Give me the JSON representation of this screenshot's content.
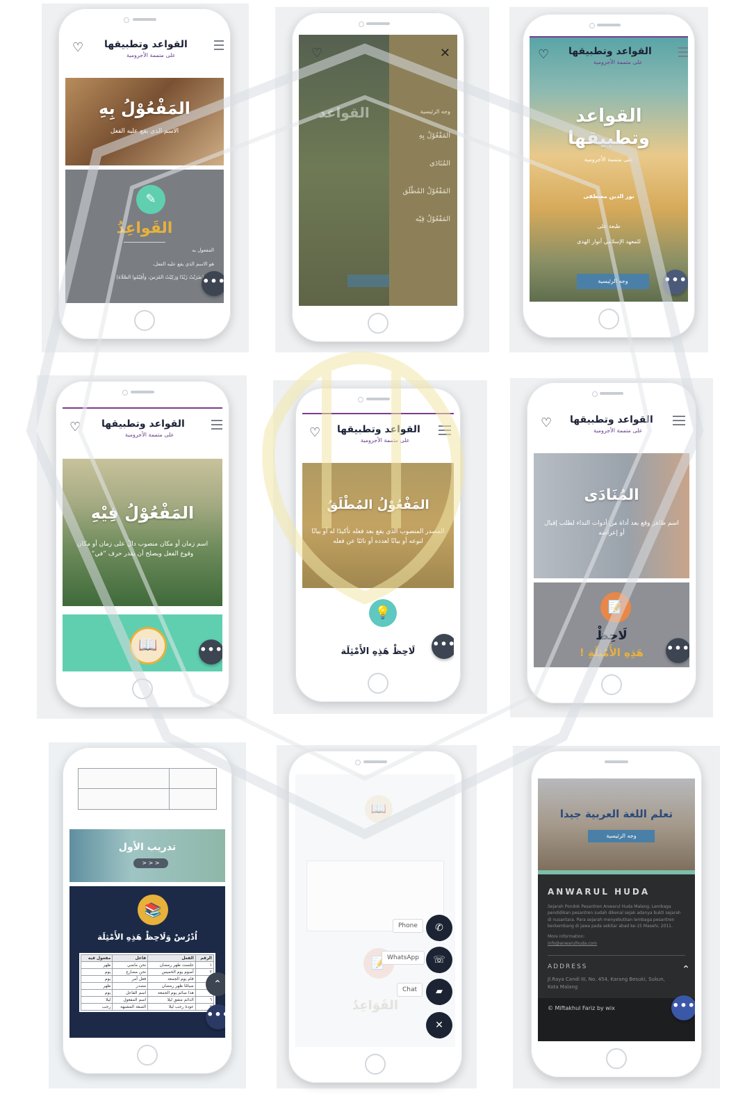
{
  "brand": {
    "title": "القواعد وتطبيقها",
    "subtitle": "على متممة الأجرومية"
  },
  "screens": {
    "s1": {
      "hero_title": "المَفْعُوْلُ بِهِ",
      "hero_text": "الاسم الذي يقع عليه الفعل",
      "section_title": "القَواعِدُ",
      "section_lines": [
        "المفعول به",
        "هو الاسم الذي يقع عليه الفعل،",
        "نحو: (ضَرَبْتُ زَيْدًا وَرَكِبْتُ الفَرَسَ، وَأَقِيْمُوا الصَّلَاةَ)"
      ]
    },
    "s2": {
      "close": "✕",
      "menu": [
        "وجه الرئيسية",
        "المَفْعُوْلُ بِهِ",
        "المُنَادَى",
        "المَفْعُوْلُ المُطْلَق",
        "المَفْعُوْلُ فِيْه"
      ]
    },
    "s3": {
      "hero_title_1": "القواعد",
      "hero_title_2": "وتطبيقها",
      "hero_sub": "على متممة الأجرومية",
      "line_a": "نور الدين مصطفى",
      "line_b": "طبعة على",
      "line_c": "للمعهد الإسلامي أنوار الهدى",
      "button": "وجه الرئيسية"
    },
    "s4": {
      "hero_title": "المَفْعُوْلُ فِيْهِ",
      "hero_text": "اسم زمان أو مكان منصوب دالٌ على زمان أو مكان وقوع الفعل ويصلح أن يقدر حرف ”في“"
    },
    "s5": {
      "hero_title": "المَفْعُوْلُ المُطْلَقُ",
      "hero_text": "المصدر المنصوب الذي يقع بعد فعله تأكيدًا له أو بيانًا لنوعه أو بيانًا لعدده أو نائبًا عن فعله",
      "section_title": "لَاحِظْ هَذِهِ الأَمْثِلَة"
    },
    "s6": {
      "hero_title": "المُنَادَى",
      "hero_text": "اسم ظاهر وقع بعد أداة من أدوات النداء لطلب إقبال أو إعراضه",
      "section_title_1": "لَاحِظْ",
      "section_title_2": "هَذِهِ الأَمْثِلَةِ !"
    },
    "s7": {
      "banner_title": "تدريب الأول",
      "banner_button": "> > >",
      "section_title": "اُدْرُسْ وَلَاحِظْ هَذِهِ الأَمْثِلَة",
      "table_header": [
        "الرقم",
        "الفعل",
        "فاعل",
        "مفعول فيه"
      ],
      "table_rows": [
        [
          "١",
          "جلست ظهر رمضان",
          "نحن ماضي",
          "ظهر"
        ],
        [
          "٢",
          "أصوم يوم الخميس",
          "نحن مضارع",
          "يوم"
        ],
        [
          "٣",
          "قام يوم الجمعة",
          "فعل أمر",
          "يوم"
        ],
        [
          "٤",
          "صيامًا ظهر رمضان",
          "مصدر",
          "ظهر"
        ],
        [
          "٥",
          "هذا صائم يوم الجمعة",
          "اسم الفاعل",
          "يوم"
        ],
        [
          "٦",
          "الدائم متفق ليلا",
          "اسم المفعول",
          "ليلا"
        ],
        [
          "٧",
          "عودة رجب ليلا",
          "الصفة المشبهة",
          "رجب"
        ]
      ]
    },
    "s8": {
      "contacts": [
        "Phone",
        "WhatsApp",
        "Chat"
      ],
      "close": "✕",
      "faded_title": "القَوَاعِدُ"
    },
    "s9": {
      "hero_title": "تعلم اللغة العربية جيدا",
      "hero_button": "وجه الرئيسية",
      "org": "ANWARUL HUDA",
      "about": "Sejarah Pondok Pesantren Anwarul Huda Malang. Lembaga pendidikan pesantren sudah dikenal sejak adanya bukti sejarah di nusantara. Para sejarah menyebutkan lembaga pesantren berkembang di jawa pada sekitar abad ke-15 Masehi, 2011.",
      "more": "More information:",
      "email": "info@anwarulhuda.com",
      "address_label": "ADDRESS",
      "address": "Jl.Raya Candi III, No. 454, Karang Besuki, Sukun, Kota Malang",
      "copyright": "© Miftakhul Fariz by wix"
    }
  },
  "fab_dots": "•••",
  "up_arrow": "⌃",
  "colors": {
    "navy": "#1c2236",
    "purple": "#7a3c8f",
    "teal": "#5fcfb0",
    "gold": "#e8b13a",
    "dark": "#3d4552"
  }
}
